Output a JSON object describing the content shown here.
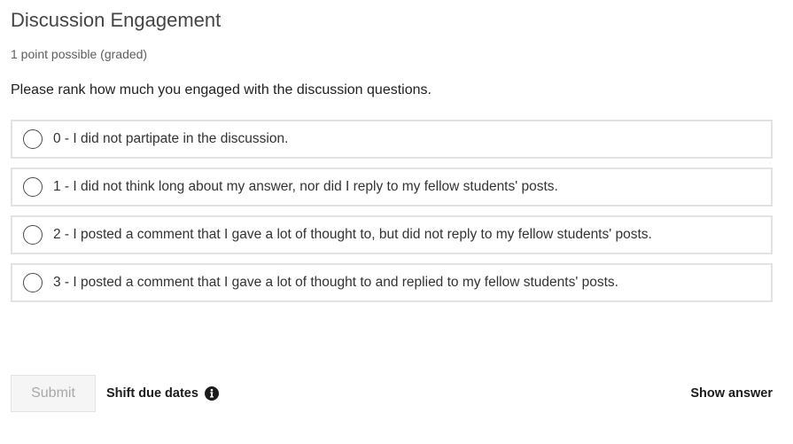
{
  "problem": {
    "title": "Discussion Engagement",
    "points": "1 point possible (graded)",
    "prompt": "Please rank how much you engaged with the discussion questions.",
    "choices": [
      {
        "label": "0 - I did not partipate in the discussion.",
        "selected": false
      },
      {
        "label": "1 - I did not think long about my answer, nor did I reply to my fellow students' posts.",
        "selected": false
      },
      {
        "label": "2 - I posted a comment that I gave a lot of thought to, but did not reply to my fellow students' posts.",
        "selected": false
      },
      {
        "label": "3 - I posted a comment that I gave a lot of thought to and replied to my fellow students' posts.",
        "selected": false
      }
    ]
  },
  "actions": {
    "submit_label": "Submit",
    "submit_enabled": false,
    "shift_due_dates_label": "Shift due dates",
    "info_icon": "info-circle-icon",
    "show_answer_label": "Show answer"
  }
}
